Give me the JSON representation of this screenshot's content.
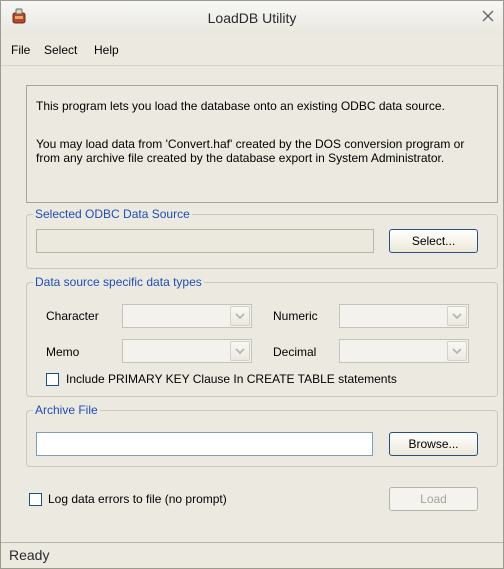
{
  "window": {
    "title": "LoadDB Utility"
  },
  "menu": {
    "items": [
      "File",
      "Select",
      "Help"
    ]
  },
  "intro": {
    "para1": "This program lets you load the database onto an existing ODBC data source.",
    "para2": "You may load data from 'Convert.haf' created by the DOS conversion program or from any archive file created by the database export in System Administrator."
  },
  "odbc": {
    "legend": "Selected ODBC Data Source",
    "value": "",
    "select_label": "Select..."
  },
  "datatypes": {
    "legend": "Data source specific data types",
    "character_label": "Character",
    "numeric_label": "Numeric",
    "memo_label": "Memo",
    "decimal_label": "Decimal",
    "character_value": "",
    "numeric_value": "",
    "memo_value": "",
    "decimal_value": "",
    "primary_key_label": "Include PRIMARY KEY Clause In CREATE TABLE statements",
    "primary_key_checked": false
  },
  "archive": {
    "legend": "Archive File",
    "value": "",
    "browse_label": "Browse..."
  },
  "log": {
    "label": "Log data errors to file (no prompt)",
    "checked": false
  },
  "load_label": "Load",
  "status": "Ready",
  "colors": {
    "window_bg": "#eceae0",
    "group_legend": "#1e4db7"
  }
}
